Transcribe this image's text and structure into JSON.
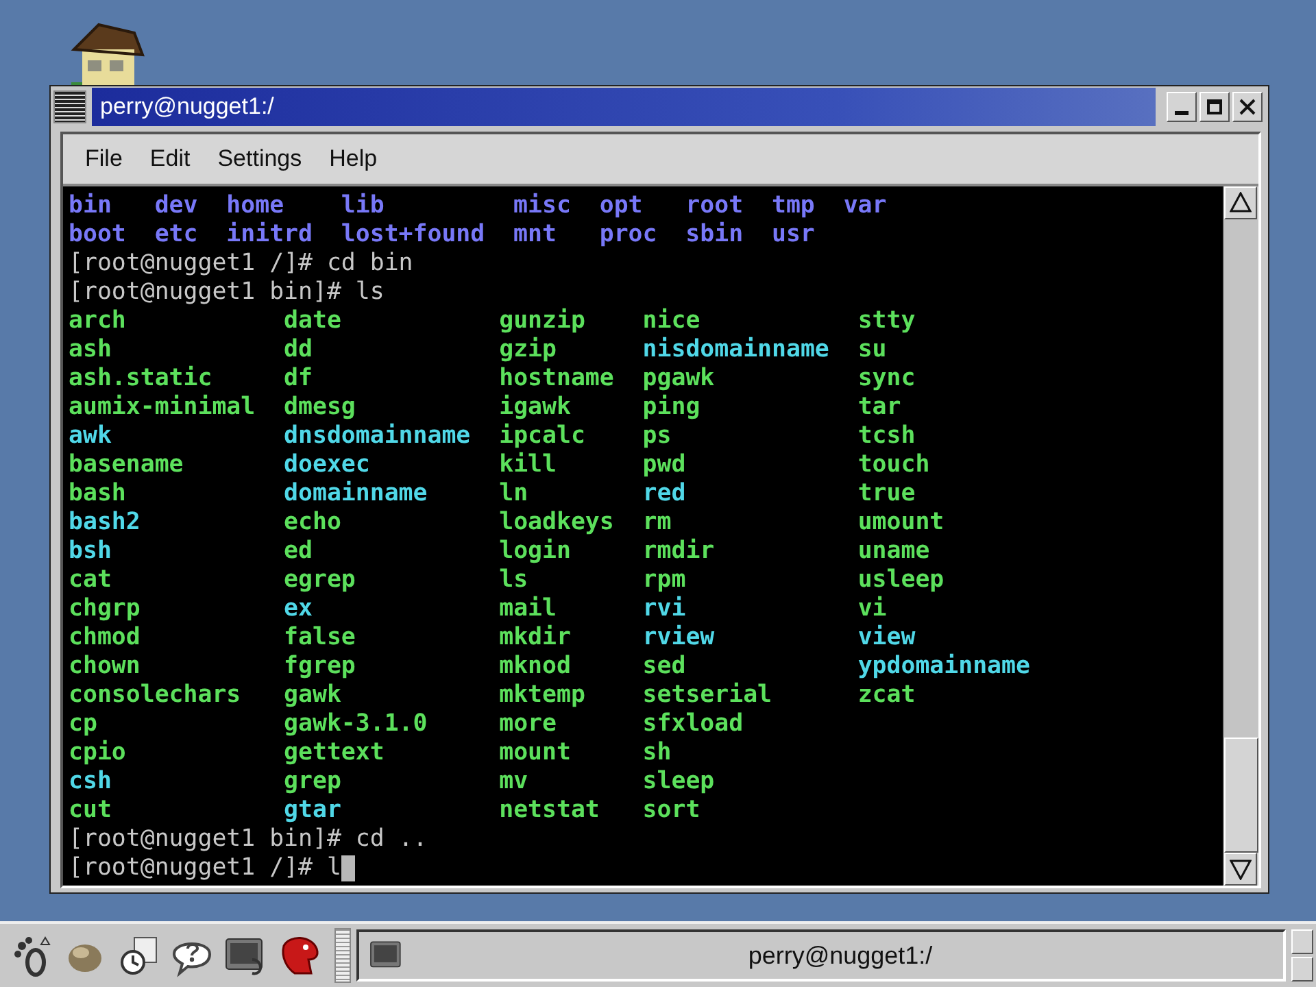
{
  "window": {
    "title": "perry@nugget1:/",
    "menu": [
      "File",
      "Edit",
      "Settings",
      "Help"
    ],
    "terminal": {
      "lines": [
        {
          "kind": "listing",
          "rows": [
            [
              {
                "text": "bin",
                "color": "#7878f8"
              },
              {
                "text": "dev",
                "color": "#7878f8"
              },
              {
                "text": "home",
                "color": "#7878f8"
              },
              {
                "text": "lib",
                "color": "#7878f8"
              },
              {
                "text": "misc",
                "color": "#7878f8"
              },
              {
                "text": "opt",
                "color": "#7878f8"
              },
              {
                "text": "root",
                "color": "#7878f8"
              },
              {
                "text": "tmp",
                "color": "#7878f8"
              },
              {
                "text": "var",
                "color": "#7878f8"
              }
            ],
            [
              {
                "text": "boot",
                "color": "#7878f8"
              },
              {
                "text": "etc",
                "color": "#7878f8"
              },
              {
                "text": "initrd",
                "color": "#7878f8"
              },
              {
                "text": "lost+found",
                "color": "#7878f8"
              },
              {
                "text": "mnt",
                "color": "#7878f8"
              },
              {
                "text": "proc",
                "color": "#7878f8"
              },
              {
                "text": "sbin",
                "color": "#7878f8"
              },
              {
                "text": "usr",
                "color": "#7878f8"
              }
            ]
          ]
        },
        {
          "kind": "prompt",
          "text": "[root@nugget1 /]# cd bin",
          "cursor": false
        },
        {
          "kind": "prompt",
          "text": "[root@nugget1 bin]# ls",
          "cursor": false
        },
        {
          "kind": "listing",
          "rows": [
            [
              {
                "text": "arch",
                "color": "#5ce05c"
              },
              {
                "text": "date",
                "color": "#5ce05c"
              },
              {
                "text": "gunzip",
                "color": "#5ce05c"
              },
              {
                "text": "nice",
                "color": "#5ce05c"
              },
              {
                "text": "stty",
                "color": "#5ce05c"
              }
            ],
            [
              {
                "text": "ash",
                "color": "#5ce05c"
              },
              {
                "text": "dd",
                "color": "#5ce05c"
              },
              {
                "text": "gzip",
                "color": "#5ce05c"
              },
              {
                "text": "nisdomainname",
                "color": "#50d8e8"
              },
              {
                "text": "su",
                "color": "#5ce05c"
              }
            ],
            [
              {
                "text": "ash.static",
                "color": "#5ce05c"
              },
              {
                "text": "df",
                "color": "#5ce05c"
              },
              {
                "text": "hostname",
                "color": "#5ce05c"
              },
              {
                "text": "pgawk",
                "color": "#5ce05c"
              },
              {
                "text": "sync",
                "color": "#5ce05c"
              }
            ],
            [
              {
                "text": "aumix-minimal",
                "color": "#5ce05c"
              },
              {
                "text": "dmesg",
                "color": "#5ce05c"
              },
              {
                "text": "igawk",
                "color": "#5ce05c"
              },
              {
                "text": "ping",
                "color": "#5ce05c"
              },
              {
                "text": "tar",
                "color": "#5ce05c"
              }
            ],
            [
              {
                "text": "awk",
                "color": "#50d8e8"
              },
              {
                "text": "dnsdomainname",
                "color": "#50d8e8"
              },
              {
                "text": "ipcalc",
                "color": "#5ce05c"
              },
              {
                "text": "ps",
                "color": "#5ce05c"
              },
              {
                "text": "tcsh",
                "color": "#5ce05c"
              }
            ],
            [
              {
                "text": "basename",
                "color": "#5ce05c"
              },
              {
                "text": "doexec",
                "color": "#50d8e8"
              },
              {
                "text": "kill",
                "color": "#5ce05c"
              },
              {
                "text": "pwd",
                "color": "#5ce05c"
              },
              {
                "text": "touch",
                "color": "#5ce05c"
              }
            ],
            [
              {
                "text": "bash",
                "color": "#5ce05c"
              },
              {
                "text": "domainname",
                "color": "#50d8e8"
              },
              {
                "text": "ln",
                "color": "#5ce05c"
              },
              {
                "text": "red",
                "color": "#50d8e8"
              },
              {
                "text": "true",
                "color": "#5ce05c"
              }
            ],
            [
              {
                "text": "bash2",
                "color": "#50d8e8"
              },
              {
                "text": "echo",
                "color": "#5ce05c"
              },
              {
                "text": "loadkeys",
                "color": "#5ce05c"
              },
              {
                "text": "rm",
                "color": "#5ce05c"
              },
              {
                "text": "umount",
                "color": "#5ce05c"
              }
            ],
            [
              {
                "text": "bsh",
                "color": "#50d8e8"
              },
              {
                "text": "ed",
                "color": "#5ce05c"
              },
              {
                "text": "login",
                "color": "#5ce05c"
              },
              {
                "text": "rmdir",
                "color": "#5ce05c"
              },
              {
                "text": "uname",
                "color": "#5ce05c"
              }
            ],
            [
              {
                "text": "cat",
                "color": "#5ce05c"
              },
              {
                "text": "egrep",
                "color": "#5ce05c"
              },
              {
                "text": "ls",
                "color": "#5ce05c"
              },
              {
                "text": "rpm",
                "color": "#5ce05c"
              },
              {
                "text": "usleep",
                "color": "#5ce05c"
              }
            ],
            [
              {
                "text": "chgrp",
                "color": "#5ce05c"
              },
              {
                "text": "ex",
                "color": "#50d8e8"
              },
              {
                "text": "mail",
                "color": "#5ce05c"
              },
              {
                "text": "rvi",
                "color": "#50d8e8"
              },
              {
                "text": "vi",
                "color": "#5ce05c"
              }
            ],
            [
              {
                "text": "chmod",
                "color": "#5ce05c"
              },
              {
                "text": "false",
                "color": "#5ce05c"
              },
              {
                "text": "mkdir",
                "color": "#5ce05c"
              },
              {
                "text": "rview",
                "color": "#50d8e8"
              },
              {
                "text": "view",
                "color": "#50d8e8"
              }
            ],
            [
              {
                "text": "chown",
                "color": "#5ce05c"
              },
              {
                "text": "fgrep",
                "color": "#5ce05c"
              },
              {
                "text": "mknod",
                "color": "#5ce05c"
              },
              {
                "text": "sed",
                "color": "#5ce05c"
              },
              {
                "text": "ypdomainname",
                "color": "#50d8e8"
              }
            ],
            [
              {
                "text": "consolechars",
                "color": "#5ce05c"
              },
              {
                "text": "gawk",
                "color": "#5ce05c"
              },
              {
                "text": "mktemp",
                "color": "#5ce05c"
              },
              {
                "text": "setserial",
                "color": "#5ce05c"
              },
              {
                "text": "zcat",
                "color": "#5ce05c"
              }
            ],
            [
              {
                "text": "cp",
                "color": "#5ce05c"
              },
              {
                "text": "gawk-3.1.0",
                "color": "#5ce05c"
              },
              {
                "text": "more",
                "color": "#5ce05c"
              },
              {
                "text": "sfxload",
                "color": "#5ce05c"
              }
            ],
            [
              {
                "text": "cpio",
                "color": "#5ce05c"
              },
              {
                "text": "gettext",
                "color": "#5ce05c"
              },
              {
                "text": "mount",
                "color": "#5ce05c"
              },
              {
                "text": "sh",
                "color": "#5ce05c"
              }
            ],
            [
              {
                "text": "csh",
                "color": "#50d8e8"
              },
              {
                "text": "grep",
                "color": "#5ce05c"
              },
              {
                "text": "mv",
                "color": "#5ce05c"
              },
              {
                "text": "sleep",
                "color": "#5ce05c"
              }
            ],
            [
              {
                "text": "cut",
                "color": "#5ce05c"
              },
              {
                "text": "gtar",
                "color": "#50d8e8"
              },
              {
                "text": "netstat",
                "color": "#5ce05c"
              },
              {
                "text": "sort",
                "color": "#5ce05c"
              }
            ]
          ]
        },
        {
          "kind": "prompt",
          "text": "[root@nugget1 bin]# cd ..",
          "cursor": false
        },
        {
          "kind": "prompt",
          "text": "[root@nugget1 /]# l",
          "cursor": true
        }
      ]
    }
  },
  "taskbar": {
    "tasks": [
      {
        "title": "perry@nugget1:/"
      }
    ]
  }
}
